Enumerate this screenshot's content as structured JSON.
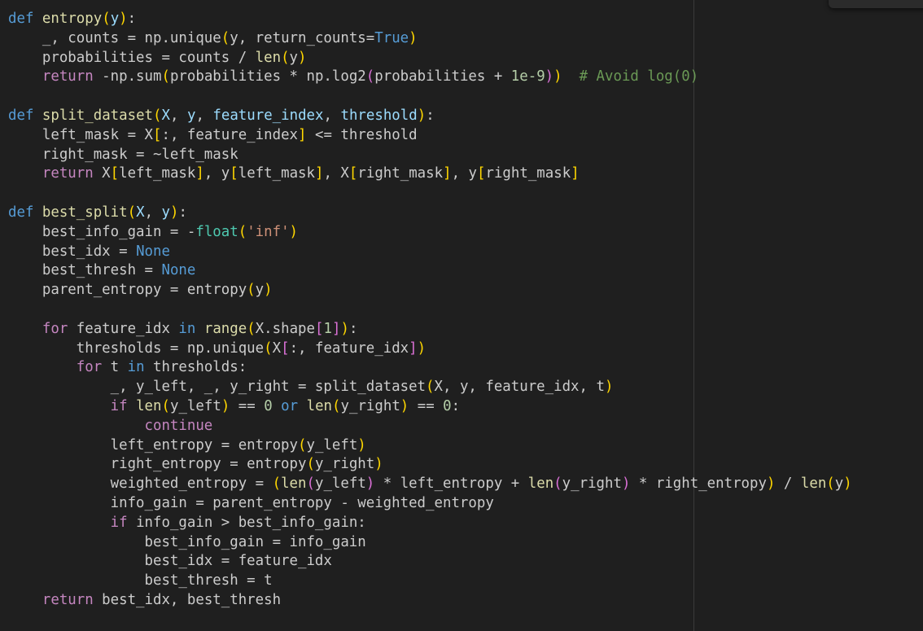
{
  "editor": {
    "language": "python",
    "colors": {
      "background": "#1f1f1f",
      "kw": "#569cd6",
      "ctrl": "#c586c0",
      "fn": "#dcdcaa",
      "var": "#cccccc",
      "param": "#9cdcfe",
      "str": "#ce9178",
      "num": "#b5cea8",
      "cmt": "#6a9955",
      "br1": "#ffd700",
      "br2": "#da70d6",
      "cls": "#4ec9b0",
      "const": "#569cd6",
      "ruler": "#3a3a3a"
    },
    "lines": [
      [
        [
          "kw",
          "def"
        ],
        [
          "var",
          " "
        ],
        [
          "fn",
          "entropy"
        ],
        [
          "br1",
          "("
        ],
        [
          "param",
          "y"
        ],
        [
          "br1",
          ")"
        ],
        [
          "var",
          ":"
        ]
      ],
      [
        [
          "var",
          "    _, counts = np.unique"
        ],
        [
          "br1",
          "("
        ],
        [
          "var",
          "y, return_counts="
        ],
        [
          "const",
          "True"
        ],
        [
          "br1",
          ")"
        ]
      ],
      [
        [
          "var",
          "    probabilities = counts / "
        ],
        [
          "fn",
          "len"
        ],
        [
          "br1",
          "("
        ],
        [
          "var",
          "y"
        ],
        [
          "br1",
          ")"
        ]
      ],
      [
        [
          "ctrl",
          "    return"
        ],
        [
          "var",
          " -np.sum"
        ],
        [
          "br1",
          "("
        ],
        [
          "var",
          "probabilities * np.log2"
        ],
        [
          "br2",
          "("
        ],
        [
          "var",
          "probabilities + "
        ],
        [
          "num",
          "1e-9"
        ],
        [
          "br2",
          ")"
        ],
        [
          "br1",
          ")"
        ],
        [
          "var",
          "  "
        ],
        [
          "cmt",
          "# Avoid log(0)"
        ]
      ],
      [],
      [
        [
          "kw",
          "def"
        ],
        [
          "var",
          " "
        ],
        [
          "fn",
          "split_dataset"
        ],
        [
          "br1",
          "("
        ],
        [
          "param",
          "X"
        ],
        [
          "var",
          ", "
        ],
        [
          "param",
          "y"
        ],
        [
          "var",
          ", "
        ],
        [
          "param",
          "feature_index"
        ],
        [
          "var",
          ", "
        ],
        [
          "param",
          "threshold"
        ],
        [
          "br1",
          ")"
        ],
        [
          "var",
          ":"
        ]
      ],
      [
        [
          "var",
          "    left_mask = X"
        ],
        [
          "br1",
          "["
        ],
        [
          "var",
          ":, feature_index"
        ],
        [
          "br1",
          "]"
        ],
        [
          "var",
          " <= threshold"
        ]
      ],
      [
        [
          "var",
          "    right_mask = ~left_mask"
        ]
      ],
      [
        [
          "ctrl",
          "    return"
        ],
        [
          "var",
          " X"
        ],
        [
          "br1",
          "["
        ],
        [
          "var",
          "left_mask"
        ],
        [
          "br1",
          "]"
        ],
        [
          "var",
          ", y"
        ],
        [
          "br1",
          "["
        ],
        [
          "var",
          "left_mask"
        ],
        [
          "br1",
          "]"
        ],
        [
          "var",
          ", X"
        ],
        [
          "br1",
          "["
        ],
        [
          "var",
          "right_mask"
        ],
        [
          "br1",
          "]"
        ],
        [
          "var",
          ", y"
        ],
        [
          "br1",
          "["
        ],
        [
          "var",
          "right_mask"
        ],
        [
          "br1",
          "]"
        ]
      ],
      [],
      [
        [
          "kw",
          "def"
        ],
        [
          "var",
          " "
        ],
        [
          "fn",
          "best_split"
        ],
        [
          "br1",
          "("
        ],
        [
          "param",
          "X"
        ],
        [
          "var",
          ", "
        ],
        [
          "param",
          "y"
        ],
        [
          "br1",
          ")"
        ],
        [
          "var",
          ":"
        ]
      ],
      [
        [
          "var",
          "    best_info_gain = -"
        ],
        [
          "cls",
          "float"
        ],
        [
          "br1",
          "("
        ],
        [
          "str",
          "'inf'"
        ],
        [
          "br1",
          ")"
        ]
      ],
      [
        [
          "var",
          "    best_idx = "
        ],
        [
          "const",
          "None"
        ]
      ],
      [
        [
          "var",
          "    best_thresh = "
        ],
        [
          "const",
          "None"
        ]
      ],
      [
        [
          "var",
          "    parent_entropy = entropy"
        ],
        [
          "br1",
          "("
        ],
        [
          "var",
          "y"
        ],
        [
          "br1",
          ")"
        ]
      ],
      [],
      [
        [
          "ctrl",
          "    for"
        ],
        [
          "var",
          " feature_idx "
        ],
        [
          "kw",
          "in"
        ],
        [
          "var",
          " "
        ],
        [
          "fn",
          "range"
        ],
        [
          "br1",
          "("
        ],
        [
          "var",
          "X.shape"
        ],
        [
          "br2",
          "["
        ],
        [
          "num",
          "1"
        ],
        [
          "br2",
          "]"
        ],
        [
          "br1",
          ")"
        ],
        [
          "var",
          ":"
        ]
      ],
      [
        [
          "var",
          "        thresholds = np.unique"
        ],
        [
          "br1",
          "("
        ],
        [
          "var",
          "X"
        ],
        [
          "br2",
          "["
        ],
        [
          "var",
          ":, feature_idx"
        ],
        [
          "br2",
          "]"
        ],
        [
          "br1",
          ")"
        ]
      ],
      [
        [
          "ctrl",
          "        for"
        ],
        [
          "var",
          " t "
        ],
        [
          "kw",
          "in"
        ],
        [
          "var",
          " thresholds:"
        ]
      ],
      [
        [
          "var",
          "            _, y_left, _, y_right = split_dataset"
        ],
        [
          "br1",
          "("
        ],
        [
          "var",
          "X, y, feature_idx, t"
        ],
        [
          "br1",
          ")"
        ]
      ],
      [
        [
          "ctrl",
          "            if"
        ],
        [
          "var",
          " "
        ],
        [
          "fn",
          "len"
        ],
        [
          "br1",
          "("
        ],
        [
          "var",
          "y_left"
        ],
        [
          "br1",
          ")"
        ],
        [
          "var",
          " == "
        ],
        [
          "num",
          "0"
        ],
        [
          "var",
          " "
        ],
        [
          "kw",
          "or"
        ],
        [
          "var",
          " "
        ],
        [
          "fn",
          "len"
        ],
        [
          "br1",
          "("
        ],
        [
          "var",
          "y_right"
        ],
        [
          "br1",
          ")"
        ],
        [
          "var",
          " == "
        ],
        [
          "num",
          "0"
        ],
        [
          "var",
          ":"
        ]
      ],
      [
        [
          "ctrl",
          "                continue"
        ]
      ],
      [
        [
          "var",
          "            left_entropy = entropy"
        ],
        [
          "br1",
          "("
        ],
        [
          "var",
          "y_left"
        ],
        [
          "br1",
          ")"
        ]
      ],
      [
        [
          "var",
          "            right_entropy = entropy"
        ],
        [
          "br1",
          "("
        ],
        [
          "var",
          "y_right"
        ],
        [
          "br1",
          ")"
        ]
      ],
      [
        [
          "var",
          "            weighted_entropy = "
        ],
        [
          "br1",
          "("
        ],
        [
          "fn",
          "len"
        ],
        [
          "br2",
          "("
        ],
        [
          "var",
          "y_left"
        ],
        [
          "br2",
          ")"
        ],
        [
          "var",
          " * left_entropy + "
        ],
        [
          "fn",
          "len"
        ],
        [
          "br2",
          "("
        ],
        [
          "var",
          "y_right"
        ],
        [
          "br2",
          ")"
        ],
        [
          "var",
          " * right_entropy"
        ],
        [
          "br1",
          ")"
        ],
        [
          "var",
          " / "
        ],
        [
          "fn",
          "len"
        ],
        [
          "br1",
          "("
        ],
        [
          "var",
          "y"
        ],
        [
          "br1",
          ")"
        ]
      ],
      [
        [
          "var",
          "            info_gain = parent_entropy - weighted_entropy"
        ]
      ],
      [
        [
          "ctrl",
          "            if"
        ],
        [
          "var",
          " info_gain > best_info_gain:"
        ]
      ],
      [
        [
          "var",
          "                best_info_gain = info_gain"
        ]
      ],
      [
        [
          "var",
          "                best_idx = feature_idx"
        ]
      ],
      [
        [
          "var",
          "                best_thresh = t"
        ]
      ],
      [
        [
          "ctrl",
          "    return"
        ],
        [
          "var",
          " best_idx, best_thresh"
        ]
      ]
    ]
  }
}
